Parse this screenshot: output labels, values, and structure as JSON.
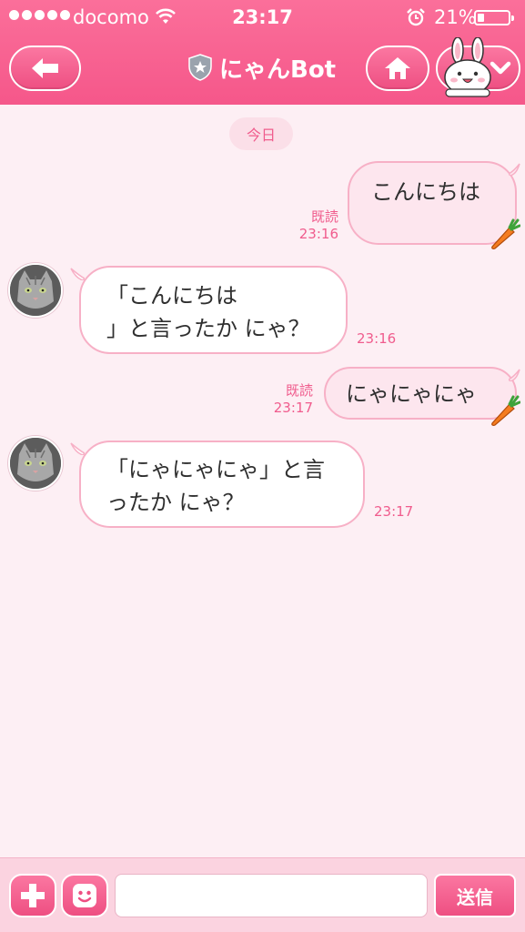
{
  "status_bar": {
    "carrier": "docomo",
    "time": "23:17",
    "battery_percent": "21%",
    "battery_level": 0.21
  },
  "header": {
    "title": "にゃんBot",
    "icons": {
      "back": "back-arrow-icon",
      "home": "home-icon",
      "menu": "chevron-down-icon",
      "verified": "shield-star-icon"
    }
  },
  "chat": {
    "date_divider": "今日",
    "messages": [
      {
        "direction": "out",
        "text": "こんにちは",
        "read": "既読",
        "time": "23:16"
      },
      {
        "direction": "in",
        "text": "「こんにちは\n」と言ったか にゃ？",
        "time": "23:16"
      },
      {
        "direction": "out",
        "text": "にゃにゃにゃ",
        "read": "既読",
        "time": "23:17"
      },
      {
        "direction": "in",
        "text": "「にゃにゃにゃ」と言\nったか にゃ？",
        "time": "23:17"
      }
    ]
  },
  "input_bar": {
    "placeholder": "",
    "send_label": "送信"
  },
  "colors": {
    "header": "#f5578a",
    "accent": "#f05c8d",
    "background": "#fdeff4"
  }
}
